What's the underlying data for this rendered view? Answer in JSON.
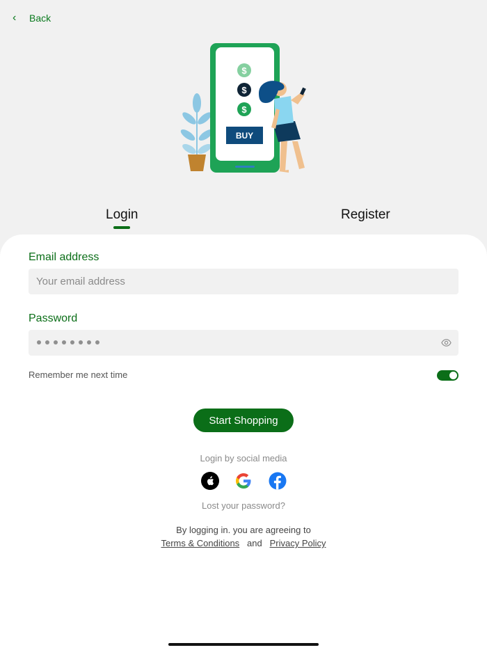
{
  "nav": {
    "back_label": "Back"
  },
  "hero": {
    "buy_label": "BUY",
    "currency_symbol": "$"
  },
  "tabs": {
    "login": "Login",
    "register": "Register",
    "active": "Login"
  },
  "form": {
    "email_label": "Email address",
    "email_placeholder": "Your email address",
    "email_value": "",
    "password_label": "Password",
    "password_masked_length": 8,
    "remember_label": "Remember me next time",
    "remember_on": true,
    "submit_label": "Start Shopping"
  },
  "social": {
    "title": "Login by social media",
    "providers": [
      "apple-icon",
      "google-icon",
      "facebook-icon"
    ]
  },
  "links": {
    "lost_password": "Lost your password?",
    "agree_text": "By logging in. you are agreeing to",
    "terms": "Terms & Conditions",
    "and": "and",
    "privacy": "Privacy Policy"
  },
  "colors": {
    "primary": "#0b6e18",
    "background": "#f1f1f1",
    "card": "#ffffff"
  }
}
